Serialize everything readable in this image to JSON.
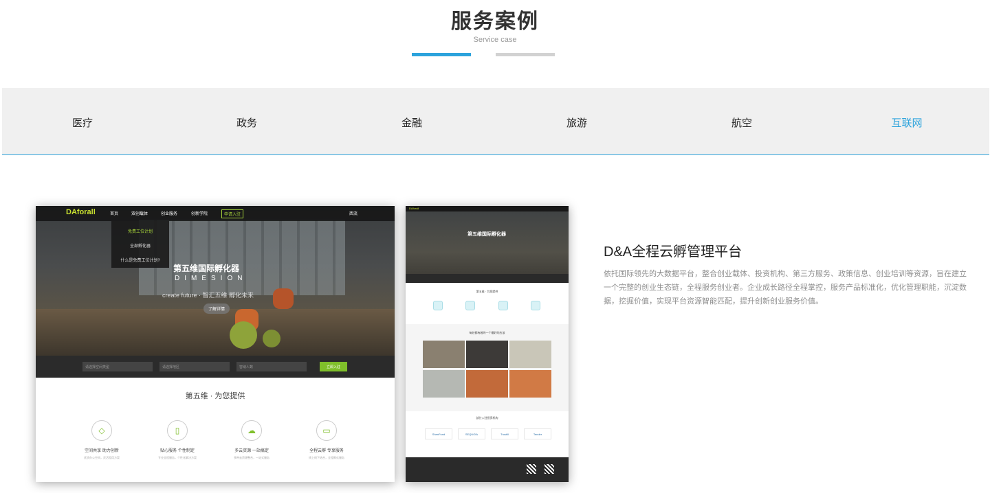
{
  "header": {
    "title": "服务案例",
    "subtitle": "Service case"
  },
  "tabs": [
    {
      "label": "医疗",
      "active": false
    },
    {
      "label": "政务",
      "active": false
    },
    {
      "label": "金融",
      "active": false
    },
    {
      "label": "旅游",
      "active": false
    },
    {
      "label": "航空",
      "active": false
    },
    {
      "label": "互联网",
      "active": true
    }
  ],
  "colors": {
    "accent": "#2ca3dc",
    "inactive_bar": "#d2d2d2",
    "tab_bg": "#f0f0f0",
    "green": "#7fbf2a"
  },
  "case": {
    "title": "D&A全程云孵管理平台",
    "description": "依托国际领先的大数据平台，整合创业载体、投资机构、第三方服务、政策信息、创业培训等资源，旨在建立一个完整的创业生态链，全程服务创业者。企业成长路径全程掌控，服务产品标准化，优化管理职能，沉淀数据，挖掘价值，实现平台资源智能匹配，提升创新创业服务价值。"
  },
  "screenshot_main": {
    "logo": "DAforall",
    "nav": [
      "首页",
      "双创载体",
      "创业服务",
      "创新学院"
    ],
    "apply_button": "申请入驻",
    "login": "西流",
    "dropdown": [
      "免费工位计划",
      "全部孵化器",
      "什么是免费工位计划?"
    ],
    "hero_title": "第五维国际孵化器",
    "hero_subtitle": "DIMESION",
    "hero_slogan": "create future · 智汇五维 孵化未来",
    "hero_button": "了解详情",
    "search_fields": [
      "请选择空间类型",
      "请选择地区",
      "容纳人数"
    ],
    "search_button": "立即入驻",
    "section_title": "第五维 · 为您提供",
    "features": [
      {
        "icon": "space-icon",
        "glyph": "◇",
        "title": "空间共享 助力创新",
        "desc": "优质办公空间，灵活租用方案"
      },
      {
        "icon": "service-icon",
        "glyph": "▯",
        "title": "贴心服务 个性制定",
        "desc": "专业全程服务，个性化解决方案"
      },
      {
        "icon": "cloud-icon",
        "glyph": "☁",
        "title": "多云资源 一站搞定",
        "desc": "多种云资源整合，一站式服务"
      },
      {
        "icon": "monitor-icon",
        "glyph": "▭",
        "title": "全程云孵 专享服务",
        "desc": "线上线下结合，全程孵化服务"
      }
    ]
  },
  "screenshot_secondary": {
    "logo": "DAforall",
    "hero_title": "第五维国际孵化器",
    "section1_title": "第五维 · 为您提供",
    "section2_title": "每处都有着的一个最好的应该",
    "section3_title": "部分入驻投资机构",
    "partners": [
      "ShenFund",
      "SEQUOIA",
      "Trustill",
      "Tender"
    ]
  }
}
